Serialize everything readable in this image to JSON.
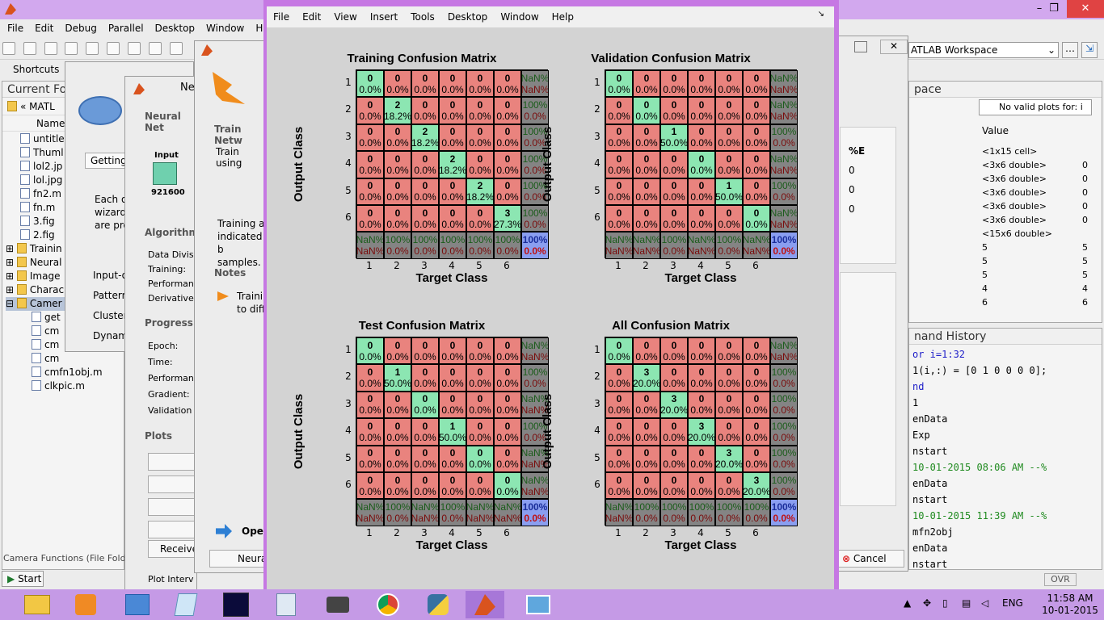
{
  "matlab": {
    "menu": [
      "File",
      "Edit",
      "Debug",
      "Parallel",
      "Desktop",
      "Window",
      "Help"
    ],
    "shortcuts": "Shortcuts",
    "current_folder_title": "Current Fo",
    "path_label": "« MATL",
    "name_header": "Name",
    "files": [
      "untitle",
      "Thuml",
      "lol2.jp",
      "lol.jpg",
      "fn2.m",
      "fn.m",
      "3.fig",
      "2.fig"
    ],
    "folders": [
      "Trainin",
      "Neural",
      "Image",
      "Charac",
      "Camer"
    ],
    "camera_files": [
      "get",
      "cm",
      "cm",
      "cm",
      "cmfn1obj.m",
      "clkpic.m"
    ],
    "folder_status": "Camera Functions (File Folde",
    "start_label": "Start",
    "ovr": "OVR",
    "workspace_dropdown": "ATLAB Workspace",
    "workspace_title": "pace",
    "no_valid_plots": "No valid plots for: i",
    "value_header": "Value",
    "workspace_values": [
      "<1x15 cell>",
      "<3x6 double>",
      "<3x6 double>",
      "<3x6 double>",
      "<3x6 double>",
      "<3x6 double>",
      "<15x6 double>",
      "5",
      "5",
      "5",
      "4",
      "6"
    ],
    "workspace_right_col": [
      "",
      "0",
      "0",
      "0",
      "0",
      "0",
      "",
      "5",
      "5",
      "5",
      "4",
      "6"
    ],
    "history_title": "nand History",
    "history_lines": [
      "or i=1:32",
      "1(i,:) = [0 1 0 0 0 0];",
      "nd",
      "1",
      "enData",
      "Exp",
      "nstart",
      "  10-01-2015 08:06 AM --%",
      "enData",
      "nstart",
      "  10-01-2015 11:39 AM --%",
      "mfn2obj",
      "enData",
      "nstart"
    ],
    "percent_e": "%E",
    "e_values": [
      "0",
      "0",
      "0"
    ],
    "cancel_label": "Cancel"
  },
  "nntool": {
    "title_partial": "Ne",
    "getting_started": "Getting",
    "wizard_text": [
      "Each of",
      "wizard",
      "are pro"
    ],
    "input_items": [
      "Input-o",
      "Pattern",
      "Cluster",
      "Dynam"
    ],
    "neural_net_label": "Neural Net",
    "input_label": "Input",
    "input_size": "921600",
    "algorithms_label": "Algorithms",
    "algo_items": [
      "Data Divisi",
      "Training:",
      "Performan",
      "Derivative:"
    ],
    "progress_label": "Progress",
    "progress_items": [
      "Epoch:",
      "Time:",
      "Performan",
      "Gradient:",
      "Validation"
    ],
    "plots_label": "Plots",
    "receive_label": "Receive",
    "plot_interval": "Plot Interv",
    "train_network": "Train Netw",
    "train_using": "Train using",
    "training_text": [
      "Training a",
      "indicated b",
      "samples."
    ],
    "notes_label": "Notes",
    "notes_text": [
      "Traini",
      "to diff"
    ],
    "open_label": "Oper",
    "neural_button": "Neura"
  },
  "figure": {
    "menu": [
      "File",
      "Edit",
      "View",
      "Insert",
      "Tools",
      "Desktop",
      "Window",
      "Help"
    ],
    "xlabel": "Target Class",
    "ylabel": "Output Class",
    "ticks": [
      "1",
      "2",
      "3",
      "4",
      "5",
      "6"
    ],
    "matrices": [
      {
        "title": "Training Confusion Matrix",
        "rows": [
          [
            [
              "0",
              "0.0%"
            ],
            [
              "0",
              "0.0%"
            ],
            [
              "0",
              "0.0%"
            ],
            [
              "0",
              "0.0%"
            ],
            [
              "0",
              "0.0%"
            ],
            [
              "0",
              "0.0%"
            ],
            [
              "NaN%",
              "NaN%"
            ]
          ],
          [
            [
              "0",
              "0.0%"
            ],
            [
              "2",
              "18.2%"
            ],
            [
              "0",
              "0.0%"
            ],
            [
              "0",
              "0.0%"
            ],
            [
              "0",
              "0.0%"
            ],
            [
              "0",
              "0.0%"
            ],
            [
              "100%",
              "0.0%"
            ]
          ],
          [
            [
              "0",
              "0.0%"
            ],
            [
              "0",
              "0.0%"
            ],
            [
              "2",
              "18.2%"
            ],
            [
              "0",
              "0.0%"
            ],
            [
              "0",
              "0.0%"
            ],
            [
              "0",
              "0.0%"
            ],
            [
              "100%",
              "0.0%"
            ]
          ],
          [
            [
              "0",
              "0.0%"
            ],
            [
              "0",
              "0.0%"
            ],
            [
              "0",
              "0.0%"
            ],
            [
              "2",
              "18.2%"
            ],
            [
              "0",
              "0.0%"
            ],
            [
              "0",
              "0.0%"
            ],
            [
              "100%",
              "0.0%"
            ]
          ],
          [
            [
              "0",
              "0.0%"
            ],
            [
              "0",
              "0.0%"
            ],
            [
              "0",
              "0.0%"
            ],
            [
              "0",
              "0.0%"
            ],
            [
              "2",
              "18.2%"
            ],
            [
              "0",
              "0.0%"
            ],
            [
              "100%",
              "0.0%"
            ]
          ],
          [
            [
              "0",
              "0.0%"
            ],
            [
              "0",
              "0.0%"
            ],
            [
              "0",
              "0.0%"
            ],
            [
              "0",
              "0.0%"
            ],
            [
              "0",
              "0.0%"
            ],
            [
              "3",
              "27.3%"
            ],
            [
              "100%",
              "0.0%"
            ]
          ],
          [
            [
              "NaN%",
              "NaN%"
            ],
            [
              "100%",
              "0.0%"
            ],
            [
              "100%",
              "0.0%"
            ],
            [
              "100%",
              "0.0%"
            ],
            [
              "100%",
              "0.0%"
            ],
            [
              "100%",
              "0.0%"
            ],
            [
              "100%",
              "0.0%"
            ]
          ]
        ]
      },
      {
        "title": "Validation Confusion Matrix",
        "rows": [
          [
            [
              "0",
              "0.0%"
            ],
            [
              "0",
              "0.0%"
            ],
            [
              "0",
              "0.0%"
            ],
            [
              "0",
              "0.0%"
            ],
            [
              "0",
              "0.0%"
            ],
            [
              "0",
              "0.0%"
            ],
            [
              "NaN%",
              "NaN%"
            ]
          ],
          [
            [
              "0",
              "0.0%"
            ],
            [
              "0",
              "0.0%"
            ],
            [
              "0",
              "0.0%"
            ],
            [
              "0",
              "0.0%"
            ],
            [
              "0",
              "0.0%"
            ],
            [
              "0",
              "0.0%"
            ],
            [
              "NaN%",
              "NaN%"
            ]
          ],
          [
            [
              "0",
              "0.0%"
            ],
            [
              "0",
              "0.0%"
            ],
            [
              "1",
              "50.0%"
            ],
            [
              "0",
              "0.0%"
            ],
            [
              "0",
              "0.0%"
            ],
            [
              "0",
              "0.0%"
            ],
            [
              "100%",
              "0.0%"
            ]
          ],
          [
            [
              "0",
              "0.0%"
            ],
            [
              "0",
              "0.0%"
            ],
            [
              "0",
              "0.0%"
            ],
            [
              "0",
              "0.0%"
            ],
            [
              "0",
              "0.0%"
            ],
            [
              "0",
              "0.0%"
            ],
            [
              "NaN%",
              "NaN%"
            ]
          ],
          [
            [
              "0",
              "0.0%"
            ],
            [
              "0",
              "0.0%"
            ],
            [
              "0",
              "0.0%"
            ],
            [
              "0",
              "0.0%"
            ],
            [
              "1",
              "50.0%"
            ],
            [
              "0",
              "0.0%"
            ],
            [
              "100%",
              "0.0%"
            ]
          ],
          [
            [
              "0",
              "0.0%"
            ],
            [
              "0",
              "0.0%"
            ],
            [
              "0",
              "0.0%"
            ],
            [
              "0",
              "0.0%"
            ],
            [
              "0",
              "0.0%"
            ],
            [
              "0",
              "0.0%"
            ],
            [
              "NaN%",
              "NaN%"
            ]
          ],
          [
            [
              "NaN%",
              "NaN%"
            ],
            [
              "NaN%",
              "NaN%"
            ],
            [
              "100%",
              "0.0%"
            ],
            [
              "NaN%",
              "NaN%"
            ],
            [
              "100%",
              "0.0%"
            ],
            [
              "NaN%",
              "NaN%"
            ],
            [
              "100%",
              "0.0%"
            ]
          ]
        ]
      },
      {
        "title": "Test Confusion Matrix",
        "rows": [
          [
            [
              "0",
              "0.0%"
            ],
            [
              "0",
              "0.0%"
            ],
            [
              "0",
              "0.0%"
            ],
            [
              "0",
              "0.0%"
            ],
            [
              "0",
              "0.0%"
            ],
            [
              "0",
              "0.0%"
            ],
            [
              "NaN%",
              "NaN%"
            ]
          ],
          [
            [
              "0",
              "0.0%"
            ],
            [
              "1",
              "50.0%"
            ],
            [
              "0",
              "0.0%"
            ],
            [
              "0",
              "0.0%"
            ],
            [
              "0",
              "0.0%"
            ],
            [
              "0",
              "0.0%"
            ],
            [
              "100%",
              "0.0%"
            ]
          ],
          [
            [
              "0",
              "0.0%"
            ],
            [
              "0",
              "0.0%"
            ],
            [
              "0",
              "0.0%"
            ],
            [
              "0",
              "0.0%"
            ],
            [
              "0",
              "0.0%"
            ],
            [
              "0",
              "0.0%"
            ],
            [
              "NaN%",
              "NaN%"
            ]
          ],
          [
            [
              "0",
              "0.0%"
            ],
            [
              "0",
              "0.0%"
            ],
            [
              "0",
              "0.0%"
            ],
            [
              "1",
              "50.0%"
            ],
            [
              "0",
              "0.0%"
            ],
            [
              "0",
              "0.0%"
            ],
            [
              "100%",
              "0.0%"
            ]
          ],
          [
            [
              "0",
              "0.0%"
            ],
            [
              "0",
              "0.0%"
            ],
            [
              "0",
              "0.0%"
            ],
            [
              "0",
              "0.0%"
            ],
            [
              "0",
              "0.0%"
            ],
            [
              "0",
              "0.0%"
            ],
            [
              "NaN%",
              "NaN%"
            ]
          ],
          [
            [
              "0",
              "0.0%"
            ],
            [
              "0",
              "0.0%"
            ],
            [
              "0",
              "0.0%"
            ],
            [
              "0",
              "0.0%"
            ],
            [
              "0",
              "0.0%"
            ],
            [
              "0",
              "0.0%"
            ],
            [
              "NaN%",
              "NaN%"
            ]
          ],
          [
            [
              "NaN%",
              "NaN%"
            ],
            [
              "100%",
              "0.0%"
            ],
            [
              "NaN%",
              "NaN%"
            ],
            [
              "100%",
              "0.0%"
            ],
            [
              "NaN%",
              "NaN%"
            ],
            [
              "NaN%",
              "NaN%"
            ],
            [
              "100%",
              "0.0%"
            ]
          ]
        ]
      },
      {
        "title": "All Confusion Matrix",
        "rows": [
          [
            [
              "0",
              "0.0%"
            ],
            [
              "0",
              "0.0%"
            ],
            [
              "0",
              "0.0%"
            ],
            [
              "0",
              "0.0%"
            ],
            [
              "0",
              "0.0%"
            ],
            [
              "0",
              "0.0%"
            ],
            [
              "NaN%",
              "NaN%"
            ]
          ],
          [
            [
              "0",
              "0.0%"
            ],
            [
              "3",
              "20.0%"
            ],
            [
              "0",
              "0.0%"
            ],
            [
              "0",
              "0.0%"
            ],
            [
              "0",
              "0.0%"
            ],
            [
              "0",
              "0.0%"
            ],
            [
              "100%",
              "0.0%"
            ]
          ],
          [
            [
              "0",
              "0.0%"
            ],
            [
              "0",
              "0.0%"
            ],
            [
              "3",
              "20.0%"
            ],
            [
              "0",
              "0.0%"
            ],
            [
              "0",
              "0.0%"
            ],
            [
              "0",
              "0.0%"
            ],
            [
              "100%",
              "0.0%"
            ]
          ],
          [
            [
              "0",
              "0.0%"
            ],
            [
              "0",
              "0.0%"
            ],
            [
              "0",
              "0.0%"
            ],
            [
              "3",
              "20.0%"
            ],
            [
              "0",
              "0.0%"
            ],
            [
              "0",
              "0.0%"
            ],
            [
              "100%",
              "0.0%"
            ]
          ],
          [
            [
              "0",
              "0.0%"
            ],
            [
              "0",
              "0.0%"
            ],
            [
              "0",
              "0.0%"
            ],
            [
              "0",
              "0.0%"
            ],
            [
              "3",
              "20.0%"
            ],
            [
              "0",
              "0.0%"
            ],
            [
              "100%",
              "0.0%"
            ]
          ],
          [
            [
              "0",
              "0.0%"
            ],
            [
              "0",
              "0.0%"
            ],
            [
              "0",
              "0.0%"
            ],
            [
              "0",
              "0.0%"
            ],
            [
              "0",
              "0.0%"
            ],
            [
              "3",
              "20.0%"
            ],
            [
              "100%",
              "0.0%"
            ]
          ],
          [
            [
              "NaN%",
              "NaN%"
            ],
            [
              "100%",
              "0.0%"
            ],
            [
              "100%",
              "0.0%"
            ],
            [
              "100%",
              "0.0%"
            ],
            [
              "100%",
              "0.0%"
            ],
            [
              "100%",
              "0.0%"
            ],
            [
              "100%",
              "0.0%"
            ]
          ]
        ]
      }
    ]
  },
  "taskbar": {
    "lang": "ENG",
    "time": "11:58 AM",
    "date": "10-01-2015",
    "apps": [
      "file-explorer-icon",
      "media-player-icon",
      "control-panel-icon",
      "notepad-icon",
      "paint-icon",
      "calculator-icon",
      "sound-icon",
      "chrome-icon",
      "python-icon",
      "matlab-icon",
      "photos-icon"
    ]
  },
  "colors": {
    "diag": "#8ce6b2",
    "off": "#e9837e",
    "summary": "#848484",
    "total": "#8a9ef0",
    "taskbar": "#c59ae6"
  }
}
